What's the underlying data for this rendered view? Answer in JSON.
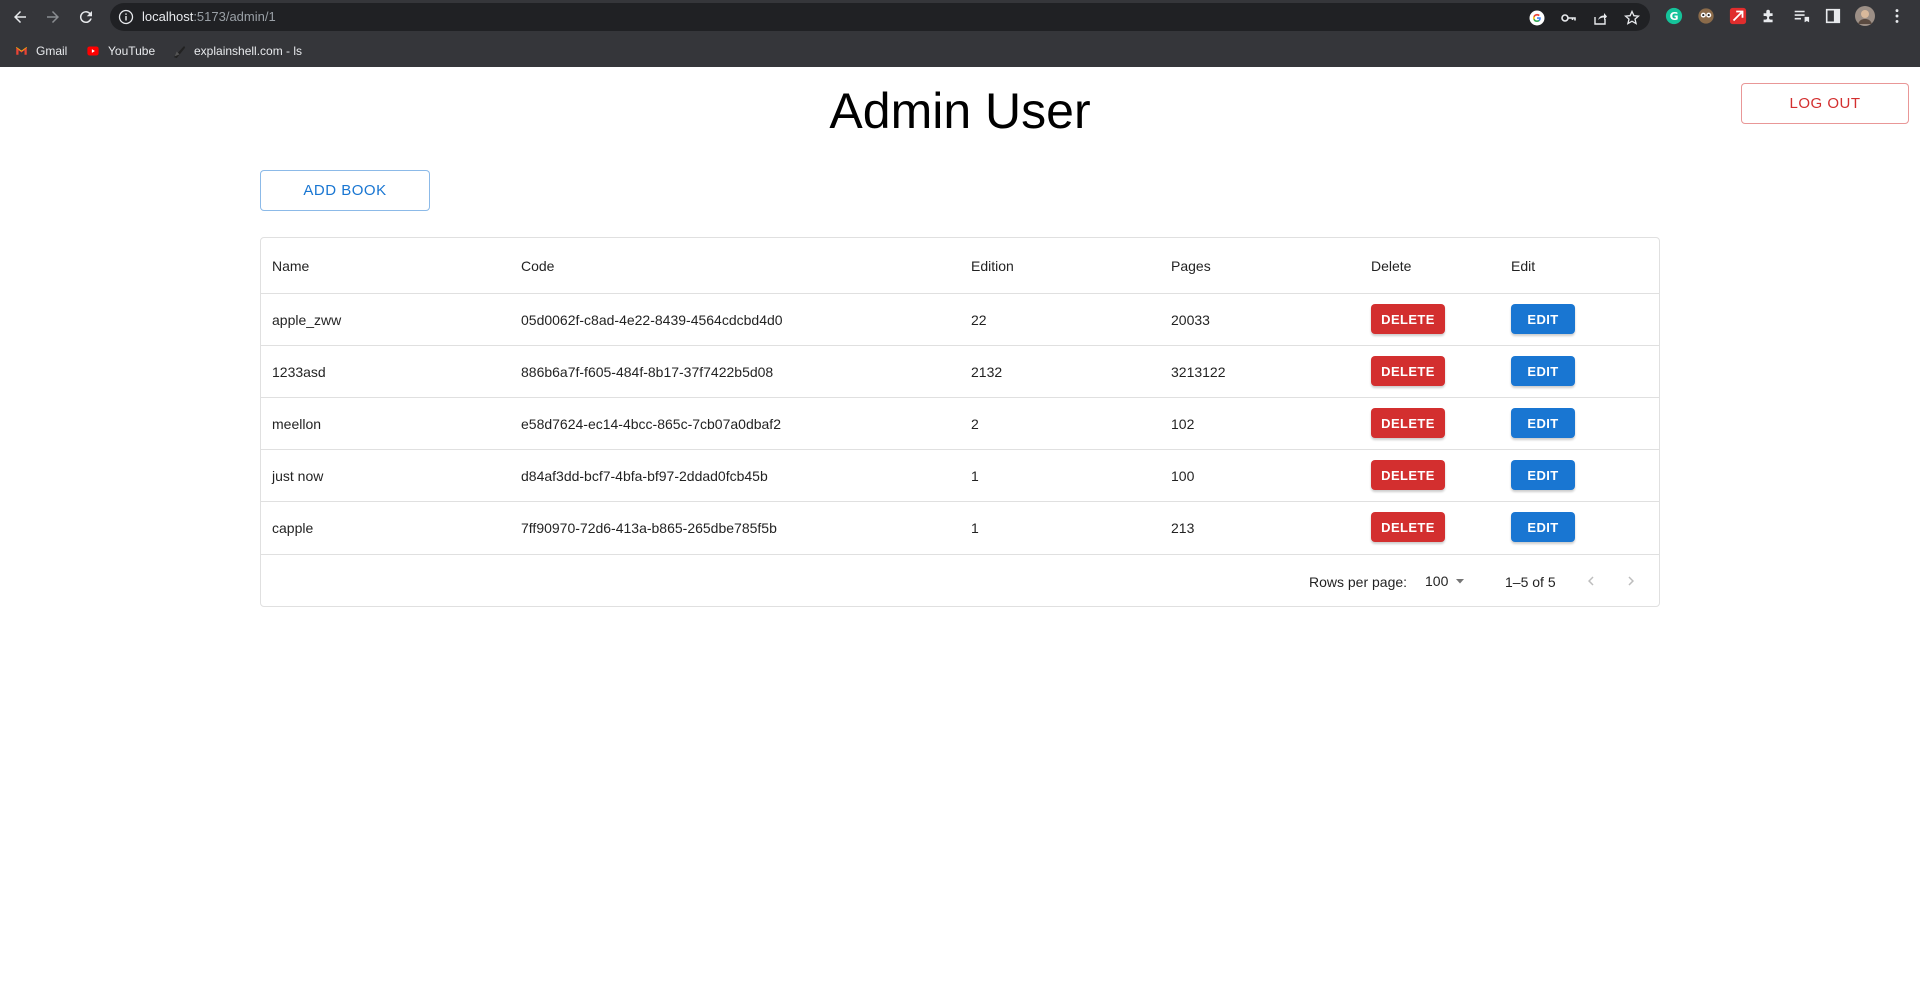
{
  "browser": {
    "url_host": "localhost",
    "url_rest": ":5173/admin/1",
    "bookmarks": [
      {
        "label": "Gmail"
      },
      {
        "label": "YouTube"
      },
      {
        "label": "explainshell.com - ls"
      }
    ]
  },
  "header": {
    "title": "Admin User",
    "logout_label": "LOG OUT"
  },
  "toolbar": {
    "add_book_label": "ADD BOOK"
  },
  "table": {
    "columns": {
      "name": "Name",
      "code": "Code",
      "edition": "Edition",
      "pages": "Pages",
      "delete": "Delete",
      "edit": "Edit"
    },
    "rows": [
      {
        "name": "apple_zww",
        "code": "05d0062f-c8ad-4e22-8439-4564cdcbd4d0",
        "edition": "22",
        "pages": "20033",
        "delete_label": "DELETE",
        "edit_label": "EDIT"
      },
      {
        "name": "1233asd",
        "code": "886b6a7f-f605-484f-8b17-37f7422b5d08",
        "edition": "2132",
        "pages": "3213122",
        "delete_label": "DELETE",
        "edit_label": "EDIT"
      },
      {
        "name": "meellon",
        "code": "e58d7624-ec14-4bcc-865c-7cb07a0dbaf2",
        "edition": "2",
        "pages": "102",
        "delete_label": "DELETE",
        "edit_label": "EDIT"
      },
      {
        "name": "just now",
        "code": "d84af3dd-bcf7-4bfa-bf97-2ddad0fcb45b",
        "edition": "1",
        "pages": "100",
        "delete_label": "DELETE",
        "edit_label": "EDIT"
      },
      {
        "name": "capple",
        "code": "7ff90970-72d6-413a-b865-265dbe785f5b",
        "edition": "1",
        "pages": "213",
        "delete_label": "DELETE",
        "edit_label": "EDIT"
      }
    ],
    "pagination": {
      "rows_per_page_label": "Rows per page:",
      "rows_per_page_value": "100",
      "range_text": "1–5 of 5"
    }
  },
  "colors": {
    "delete": "#d32f2f",
    "edit": "#1976d2",
    "chrome": "#35363a"
  }
}
